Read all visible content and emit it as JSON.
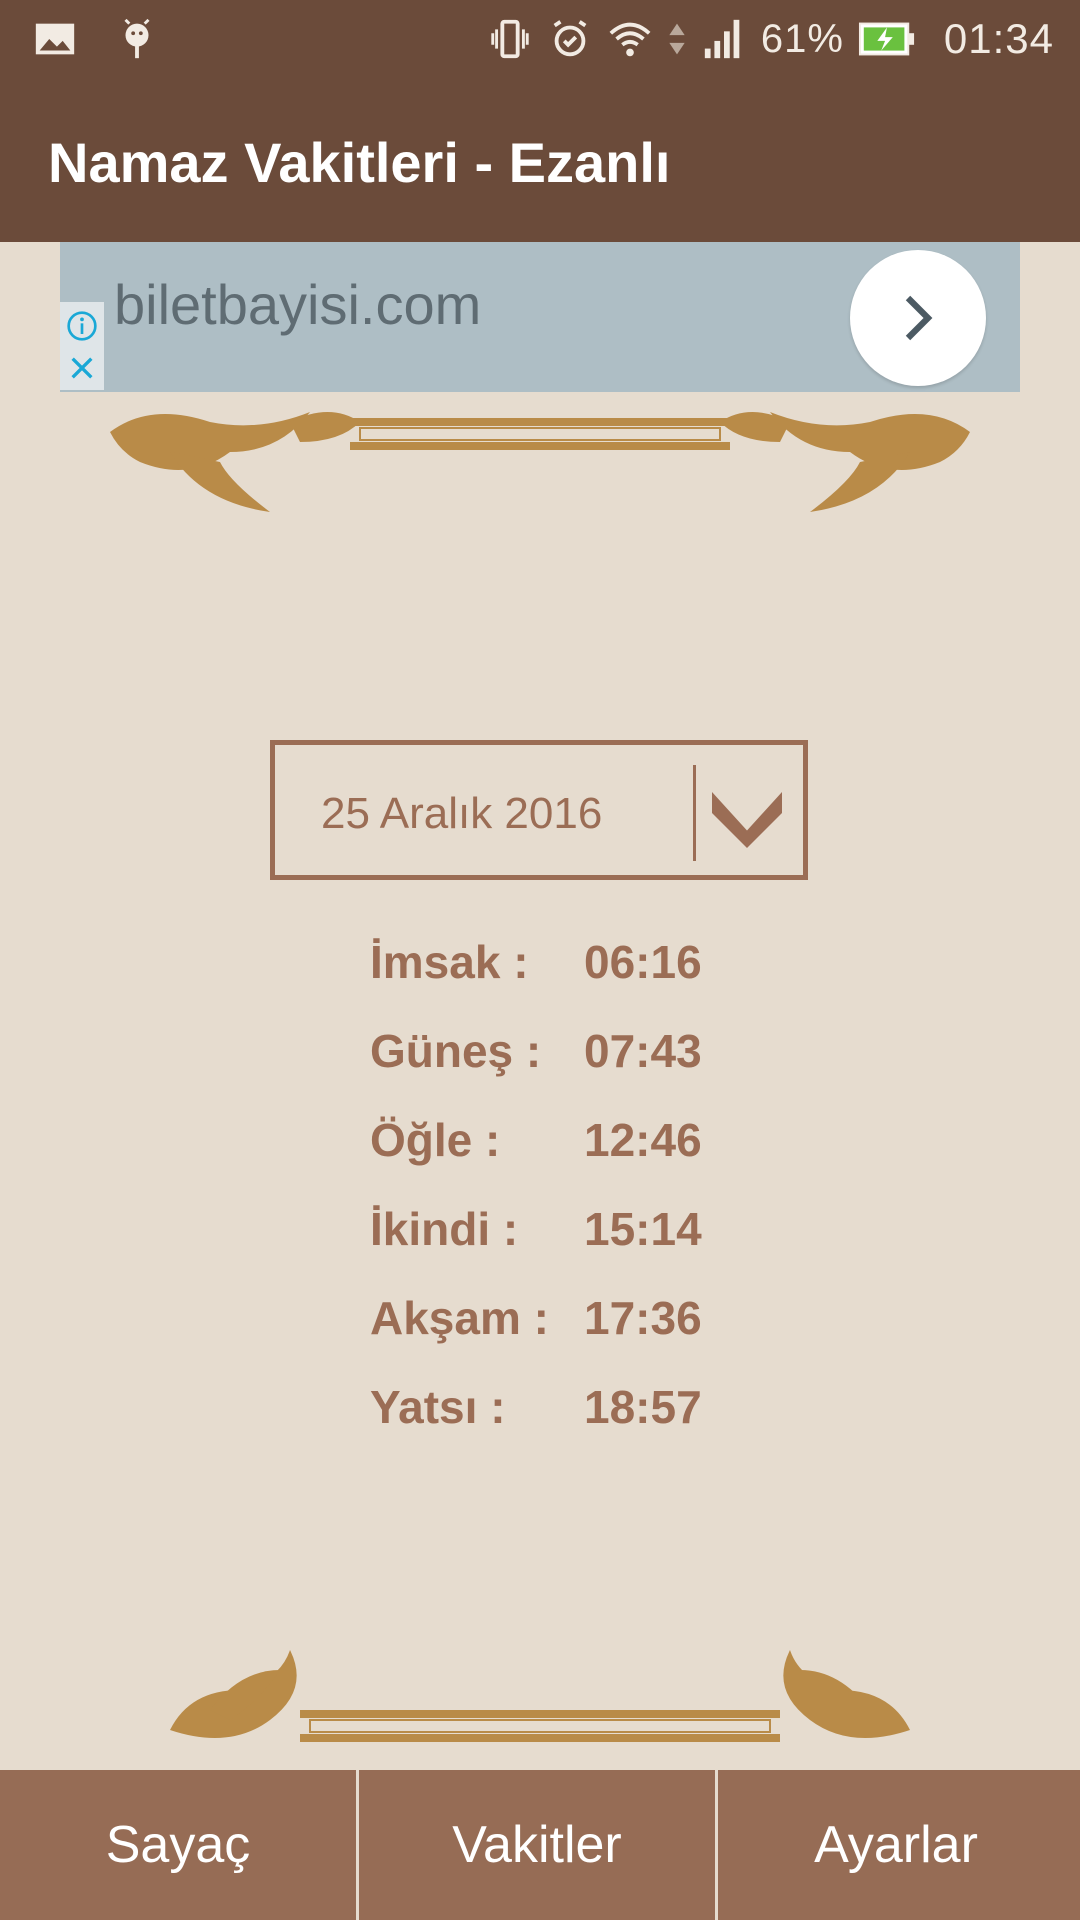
{
  "status_bar": {
    "battery_percent": "61%",
    "time": "01:34",
    "icons": [
      "gallery-icon",
      "android-debug-icon",
      "vibrate-icon",
      "alarm-icon",
      "wifi-icon",
      "data-arrows-icon",
      "signal-icon",
      "battery-charging-icon"
    ]
  },
  "app_bar": {
    "title": "Namaz Vakitleri - Ezanlı"
  },
  "ad": {
    "brand_text": "biletbayisi.com"
  },
  "date_select": {
    "value": "25 Aralık 2016"
  },
  "prayer_times": [
    {
      "label": "İmsak :",
      "time": "06:16"
    },
    {
      "label": "Güneş :",
      "time": "07:43"
    },
    {
      "label": "Öğle :",
      "time": "12:46"
    },
    {
      "label": "İkindi :",
      "time": "15:14"
    },
    {
      "label": "Akşam :",
      "time": "17:36"
    },
    {
      "label": "Yatsı :",
      "time": "18:57"
    }
  ],
  "bottom_nav": [
    {
      "label": "Sayaç"
    },
    {
      "label": "Vakitler"
    },
    {
      "label": "Ayarlar"
    }
  ],
  "colors": {
    "app_bar": "#6b4b3a",
    "background": "#e6dccf",
    "accent_text": "#9b6d55",
    "nav_bg": "#966c55",
    "ornament": "#b98b48",
    "ad_bg": "#aebec5"
  }
}
